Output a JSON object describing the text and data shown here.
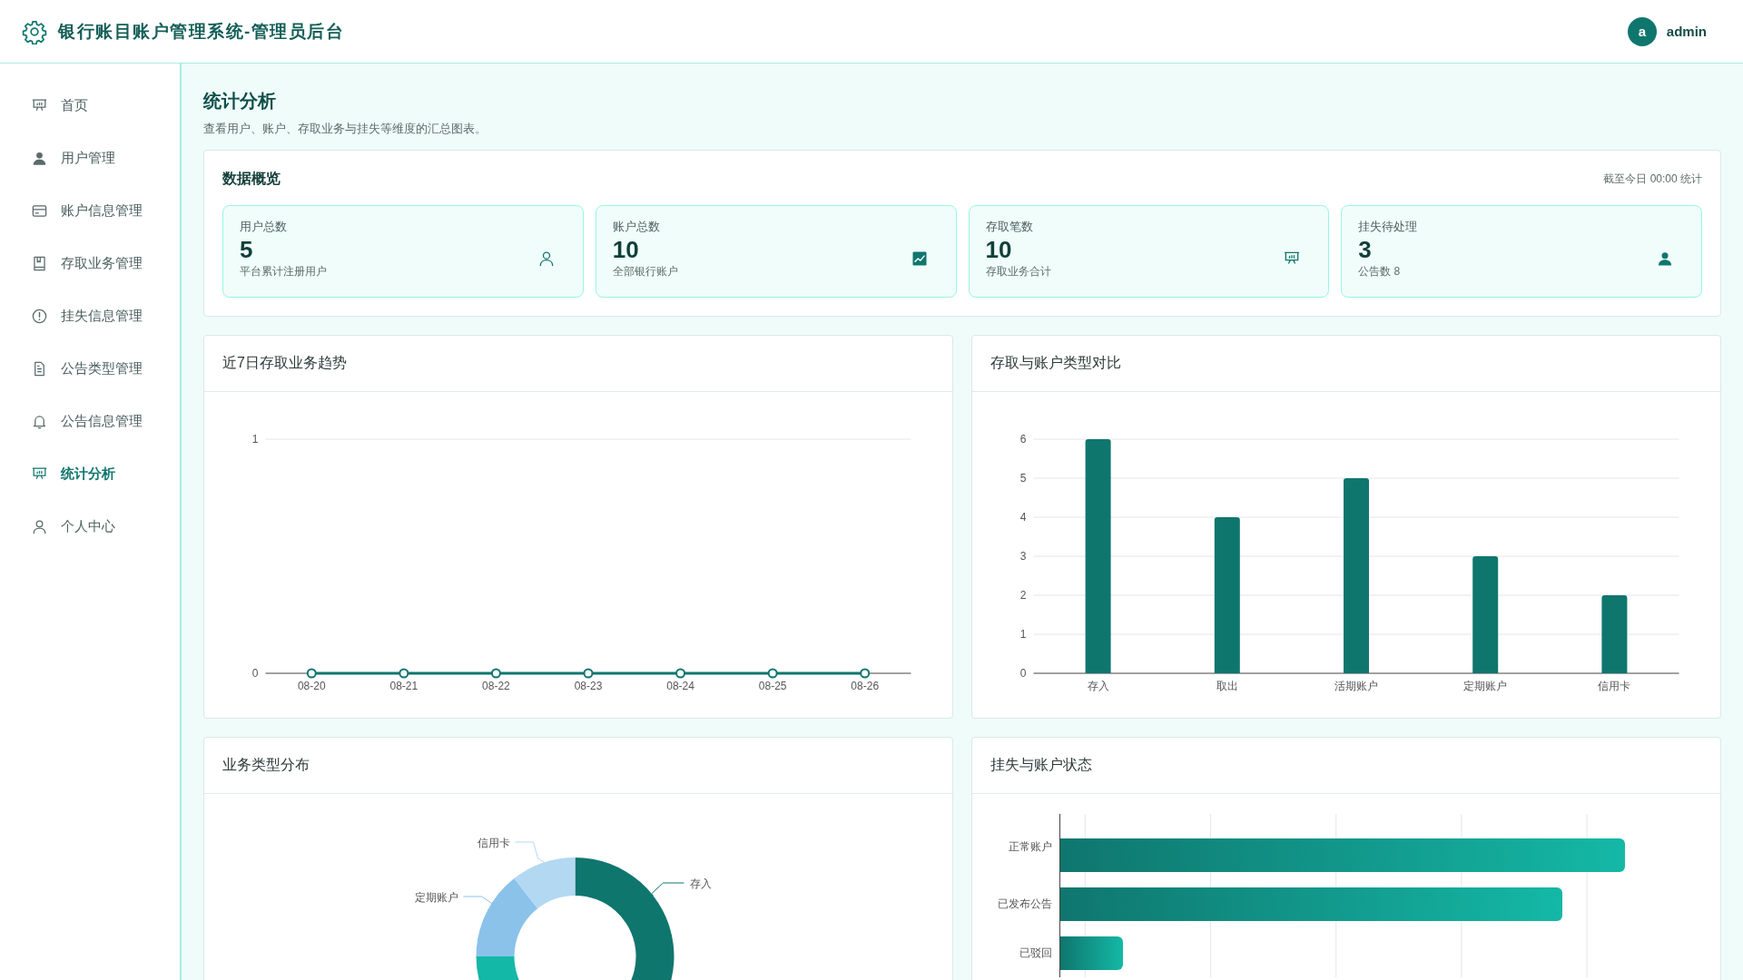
{
  "header": {
    "title": "银行账目账户管理系统-管理员后台",
    "user": {
      "avatar": "a",
      "name": "admin"
    }
  },
  "sidebar": {
    "items": [
      {
        "label": "首页",
        "selected": false
      },
      {
        "label": "用户管理",
        "selected": false
      },
      {
        "label": "账户信息管理",
        "selected": false
      },
      {
        "label": "存取业务管理",
        "selected": false
      },
      {
        "label": "挂失信息管理",
        "selected": false
      },
      {
        "label": "公告类型管理",
        "selected": false
      },
      {
        "label": "公告信息管理",
        "selected": false
      },
      {
        "label": "统计分析",
        "selected": true
      },
      {
        "label": "个人中心",
        "selected": false
      }
    ]
  },
  "page": {
    "title": "统计分析",
    "subtitle": "查看用户、账户、存取业务与挂失等维度的汇总图表。"
  },
  "overview": {
    "title": "数据概览",
    "note": "截至今日 00:00 统计",
    "stats": [
      {
        "label": "用户总数",
        "value": "5",
        "caption": "平台累计注册用户"
      },
      {
        "label": "账户总数",
        "value": "10",
        "caption": "全部银行账户"
      },
      {
        "label": "存取笔数",
        "value": "10",
        "caption": "存取业务合计"
      },
      {
        "label": "挂失待处理",
        "value": "3",
        "caption": "公告数 8"
      }
    ]
  },
  "charts": [
    {
      "title": "近7日存取业务趋势",
      "chart_data": {
        "type": "line",
        "categories": [
          "08-20",
          "08-21",
          "08-22",
          "08-23",
          "08-24",
          "08-25",
          "08-26"
        ],
        "series": [
          {
            "color": "#0f766e",
            "marker": "circle",
            "values": [
              0,
              0,
              0,
              0,
              0,
              0,
              0
            ]
          }
        ],
        "ylim": [
          0,
          1
        ],
        "yticks": [
          0,
          1
        ],
        "grid": true
      }
    },
    {
      "title": "存取与账户类型对比",
      "chart_data": {
        "type": "bar",
        "categories": [
          "存入",
          "取出",
          "活期账户",
          "定期账户",
          "信用卡"
        ],
        "series": [
          {
            "color": "#0f766e",
            "values": [
              6,
              4,
              5,
              3,
              2
            ]
          }
        ],
        "ylim": [
          0,
          6
        ],
        "yticks": [
          0,
          1,
          2,
          3,
          4,
          5,
          6
        ],
        "grid": true
      }
    }
  ],
  "distribution": {
    "title": "业务类型分布",
    "labels": [
      {
        "text": "信用卡",
        "color": "#b3d8f2"
      },
      {
        "text": "定期账户",
        "color": "#8bc2ea"
      },
      {
        "text": "存入",
        "color": "#0f766e"
      }
    ]
  },
  "status": {
    "title": "挂失与账户状态",
    "bars": [
      {
        "label": "正常账户",
        "level": 0.9
      },
      {
        "label": "已发布公告",
        "level": 0.8
      },
      {
        "label": "已驳回",
        "level": 0.1
      }
    ]
  }
}
